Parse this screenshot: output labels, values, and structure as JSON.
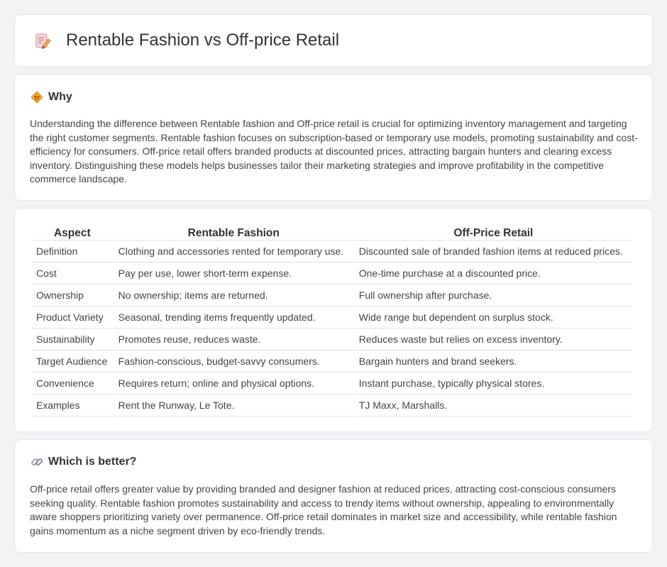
{
  "header": {
    "title": "Rentable Fashion vs Off-price Retail",
    "icon": "memo-pencil-icon"
  },
  "why": {
    "icon": "diamond-badge-icon",
    "title": "Why",
    "text": "Understanding the difference between Rentable fashion and Off-price retail is crucial for optimizing inventory management and targeting the right customer segments. Rentable fashion focuses on subscription-based or temporary use models, promoting sustainability and cost-efficiency for consumers. Off-price retail offers branded products at discounted prices, attracting bargain hunters and clearing excess inventory. Distinguishing these models helps businesses tailor their marketing strategies and improve profitability in the competitive commerce landscape."
  },
  "comparison": {
    "headers": [
      "Aspect",
      "Rentable Fashion",
      "Off-Price Retail"
    ],
    "rows": [
      [
        "Definition",
        "Clothing and accessories rented for temporary use.",
        "Discounted sale of branded fashion items at reduced prices."
      ],
      [
        "Cost",
        "Pay per use, lower short-term expense.",
        "One-time purchase at a discounted price."
      ],
      [
        "Ownership",
        "No ownership; items are returned.",
        "Full ownership after purchase."
      ],
      [
        "Product Variety",
        "Seasonal, trending items frequently updated.",
        "Wide range but dependent on surplus stock."
      ],
      [
        "Sustainability",
        "Promotes reuse, reduces waste.",
        "Reduces waste but relies on excess inventory."
      ],
      [
        "Target Audience",
        "Fashion-conscious, budget-savvy consumers.",
        "Bargain hunters and brand seekers."
      ],
      [
        "Convenience",
        "Requires return; online and physical options.",
        "Instant purchase, typically physical stores."
      ],
      [
        "Examples",
        "Rent the Runway, Le Tote.",
        "TJ Maxx, Marshalls."
      ]
    ]
  },
  "better": {
    "icon": "link-icon",
    "title": "Which is better?",
    "text": "Off-price retail offers greater value by providing branded and designer fashion at reduced prices, attracting cost-conscious consumers seeking quality. Rentable fashion promotes sustainability and access to trendy items without ownership, appealing to environmentally aware shoppers prioritizing variety over permanence. Off-price retail dominates in market size and accessibility, while rentable fashion gains momentum as a niche segment driven by eco-friendly trends."
  }
}
